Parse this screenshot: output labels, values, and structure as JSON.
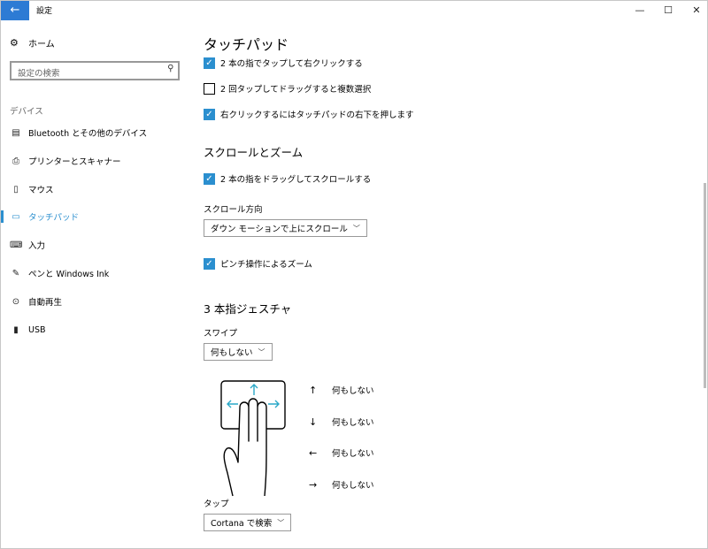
{
  "window": {
    "title": "設定"
  },
  "sidebar": {
    "home_label": "ホーム",
    "search_placeholder": "設定の検索",
    "section": "デバイス",
    "items": [
      {
        "label": "Bluetooth とその他のデバイス",
        "icon": "bluetooth-devices-icon"
      },
      {
        "label": "プリンターとスキャナー",
        "icon": "printer-icon"
      },
      {
        "label": "マウス",
        "icon": "mouse-icon"
      },
      {
        "label": "タッチパッド",
        "icon": "touchpad-icon",
        "active": true
      },
      {
        "label": "入力",
        "icon": "keyboard-icon"
      },
      {
        "label": "ペンと Windows Ink",
        "icon": "pen-icon"
      },
      {
        "label": "自動再生",
        "icon": "autoplay-icon"
      },
      {
        "label": "USB",
        "icon": "usb-icon"
      }
    ]
  },
  "main": {
    "title": "タッチパッド",
    "checks": [
      {
        "label": "2 本の指でタップして右クリックする",
        "checked": true
      },
      {
        "label": "2 回タップしてドラッグすると複数選択",
        "checked": false
      },
      {
        "label": "右クリックするにはタッチパッドの右下を押します",
        "checked": true
      }
    ],
    "scroll_zoom": {
      "heading": "スクロールとズーム",
      "drag_scroll_label": "2 本の指をドラッグしてスクロールする",
      "drag_scroll_checked": true,
      "direction_label": "スクロール方向",
      "direction_value": "ダウン モーションで上にスクロール",
      "pinch_zoom_label": "ピンチ操作によるズーム",
      "pinch_zoom_checked": true
    },
    "three_finger": {
      "heading": "3 本指ジェスチャ",
      "swipe_label": "スワイプ",
      "swipe_value": "何もしない",
      "directions": [
        {
          "arrow": "↑",
          "label": "何もしない"
        },
        {
          "arrow": "↓",
          "label": "何もしない"
        },
        {
          "arrow": "←",
          "label": "何もしない"
        },
        {
          "arrow": "→",
          "label": "何もしない"
        }
      ],
      "tap_label": "タップ",
      "tap_value": "Cortana で検索"
    }
  },
  "colors": {
    "accent": "#2b8fcf",
    "back_button": "#2d7bd4"
  }
}
